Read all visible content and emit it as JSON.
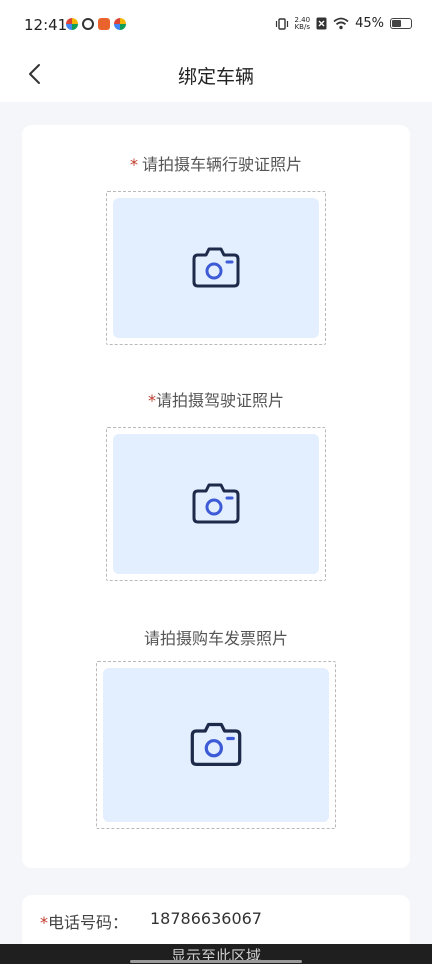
{
  "status_bar": {
    "time": "12:41",
    "net_speed_value": "2.40",
    "net_speed_unit": "KB/s",
    "battery_percent": "45%",
    "battery_level": 0.45
  },
  "header": {
    "title": "绑定车辆",
    "back_icon": "back-chevron-icon"
  },
  "sections": [
    {
      "required_mark": "*",
      "label": "请拍摄车辆行驶证照片",
      "icon": "camera-icon"
    },
    {
      "required_mark": "*",
      "label": "请拍摄驾驶证照片",
      "icon": "camera-icon"
    },
    {
      "required_mark": "",
      "label": "请拍摄购车发票照片",
      "icon": "camera-icon"
    }
  ],
  "phone": {
    "required_mark": "*",
    "label": "电话号码：",
    "value": "18786636067"
  },
  "bottom_bar": {
    "text": "显示至此区域"
  },
  "colors": {
    "accent": "#3d5bd6",
    "upload_bg": "#e3eefe",
    "required": "#c0392b"
  }
}
